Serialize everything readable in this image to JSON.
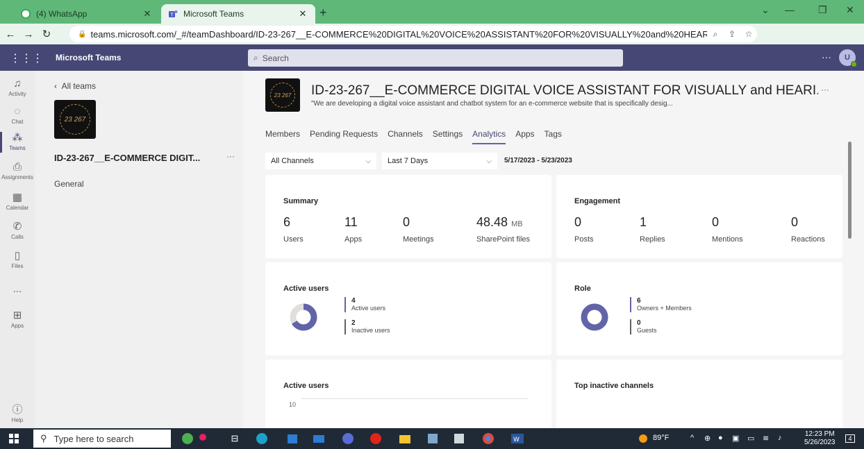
{
  "browser": {
    "tabs": [
      {
        "label": "(4) WhatsApp",
        "icon": "whatsapp-icon"
      },
      {
        "label": "Microsoft Teams",
        "icon": "teams-icon"
      }
    ],
    "url": "teams.microsoft.com/_#/teamDashboard/ID-23-267__E-COMMERCE%20DIGITAL%20VOICE%20ASSISTANT%20FOR%20VISUALLY%20and%20HEARING%..."
  },
  "header": {
    "app_title": "Microsoft Teams",
    "search_placeholder": "Search",
    "avatar_initial": "U"
  },
  "appbar": {
    "items": [
      {
        "label": "Activity",
        "icon": "bell-icon"
      },
      {
        "label": "Chat",
        "icon": "chat-icon"
      },
      {
        "label": "Teams",
        "icon": "teams-icon"
      },
      {
        "label": "Assignments",
        "icon": "assignments-icon"
      },
      {
        "label": "Calendar",
        "icon": "calendar-icon"
      },
      {
        "label": "Calls",
        "icon": "phone-icon"
      },
      {
        "label": "Files",
        "icon": "file-icon"
      },
      {
        "label": "...",
        "icon": "more-icon"
      },
      {
        "label": "Apps",
        "icon": "apps-icon"
      },
      {
        "label": "Help",
        "icon": "help-icon"
      }
    ]
  },
  "teampanel": {
    "back_label": "All teams",
    "logo_text": "23 267",
    "team_name": "ID-23-267__E-COMMERCE DIGIT...",
    "channel": "General"
  },
  "main": {
    "logo_text": "23 267",
    "title": "ID-23-267__E-COMMERCE DIGITAL VOICE ASSISTANT FOR VISUALLY and HEARI...",
    "description": "\"We are developing a digital voice assistant and chatbot system for an e-commerce website that is specifically desig...",
    "tabs": [
      "Members",
      "Pending Requests",
      "Channels",
      "Settings",
      "Analytics",
      "Apps",
      "Tags"
    ],
    "active_tab": "Analytics",
    "channel_filter": "All Channels",
    "period_filter": "Last 7 Days",
    "date_range": "5/17/2023 - 5/23/2023",
    "summary": {
      "title": "Summary",
      "stats": [
        {
          "value": "6",
          "label": "Users"
        },
        {
          "value": "11",
          "label": "Apps"
        },
        {
          "value": "0",
          "label": "Meetings"
        },
        {
          "value": "48.48",
          "unit": "MB",
          "label": "SharePoint files"
        }
      ]
    },
    "engagement": {
      "title": "Engagement",
      "stats": [
        {
          "value": "0",
          "label": "Posts"
        },
        {
          "value": "1",
          "label": "Replies"
        },
        {
          "value": "0",
          "label": "Mentions"
        },
        {
          "value": "0",
          "label": "Reactions"
        }
      ]
    },
    "active_users": {
      "title": "Active users",
      "active_count": "4",
      "active_label": "Active users",
      "inactive_count": "2",
      "inactive_label": "Inactive users",
      "active_fraction": 0.667
    },
    "role": {
      "title": "Role",
      "owners_count": "6",
      "owners_label": "Owners + Members",
      "guests_count": "0",
      "guests_label": "Guests",
      "owners_fraction": 1.0
    },
    "active_users_chart": {
      "title": "Active users",
      "y_tick": "10"
    },
    "top_inactive": {
      "title": "Top inactive channels"
    }
  },
  "colors": {
    "teams_purple": "#464775",
    "accent": "#6264a7",
    "chrome_green": "#5fb878"
  },
  "taskbar": {
    "search_placeholder": "Type here to search",
    "weather": "89°F",
    "time": "12:23 PM",
    "date": "5/26/2023",
    "notification_count": "4"
  }
}
